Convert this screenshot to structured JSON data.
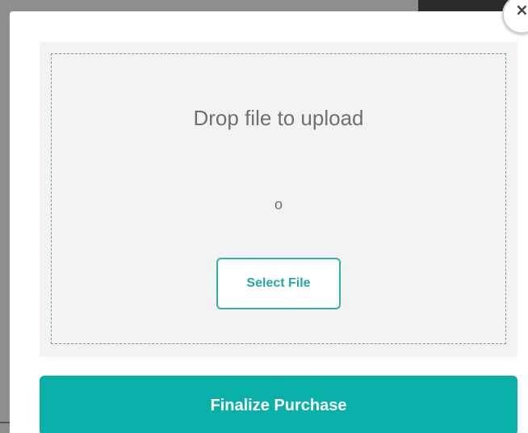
{
  "upload": {
    "drop_text": "Drop file to upload",
    "or_text": "o",
    "select_button_label": "Select File"
  },
  "actions": {
    "finalize_label": "Finalize Purchase"
  },
  "close_button": {
    "icon": "close-icon",
    "glyph": "×"
  },
  "colors": {
    "accent": "#08b0a8",
    "select_border": "#2fb1ab",
    "drop_zone_bg": "#f3f3f3",
    "text_muted": "#707070"
  }
}
